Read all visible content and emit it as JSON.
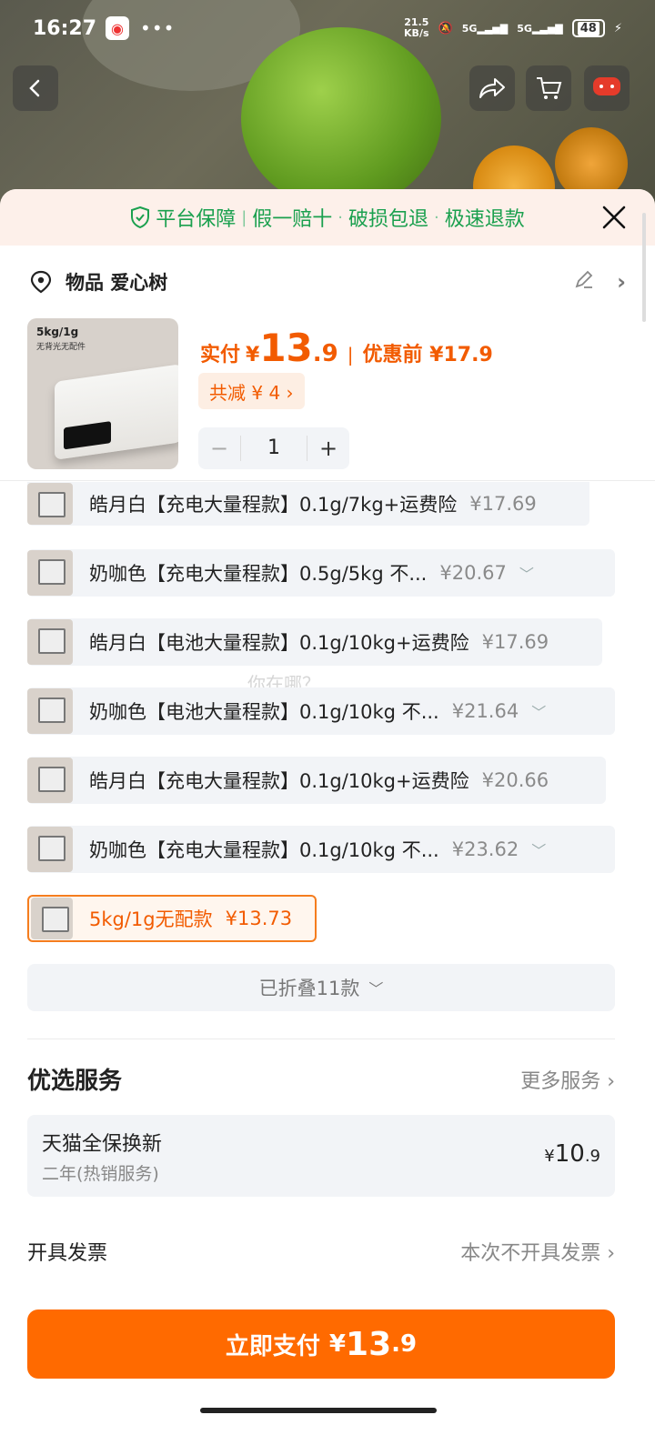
{
  "status": {
    "time": "16:27",
    "dots": "•••",
    "net_speed": "21.5",
    "net_unit": "KB/s",
    "sig1": "5G",
    "sig2": "5G",
    "battery": "48"
  },
  "banner": {
    "shield_label": "平台保障",
    "items": [
      "假一赔十",
      "破损包退",
      "极速退款"
    ],
    "separators": [
      "|",
      "·",
      "·"
    ]
  },
  "address": {
    "text": "物品 爱心树"
  },
  "product": {
    "thumb_title": "5kg/1g",
    "thumb_sub": "无背光无配件",
    "pay_label": "实付",
    "currency": "¥",
    "pay_int": "13",
    "pay_dec": ".9",
    "orig_label": "优惠前 ¥17.9",
    "reduce_label": "共减 ¥ 4 ›",
    "qty": "1",
    "minus": "−",
    "plus": "+"
  },
  "options": [
    {
      "name": "皓月白【充电大量程款】0.1g/7kg+运费险",
      "price": "¥17.69",
      "chev": ""
    },
    {
      "name": "奶咖色【充电大量程款】0.5g/5kg 不...",
      "price": "¥20.67",
      "chev": "﹀"
    },
    {
      "name": "皓月白【电池大量程款】0.1g/10kg+运费险",
      "price": "¥17.69",
      "chev": ""
    },
    {
      "name": "奶咖色【电池大量程款】0.1g/10kg 不...",
      "price": "¥21.64",
      "chev": "﹀"
    },
    {
      "name": "皓月白【充电大量程款】0.1g/10kg+运费险",
      "price": "¥20.66",
      "chev": ""
    },
    {
      "name": "奶咖色【充电大量程款】0.1g/10kg 不...",
      "price": "¥23.62",
      "chev": "﹀"
    },
    {
      "name": "5kg/1g无配款",
      "price": "¥13.73",
      "chev": ""
    }
  ],
  "ghost_text": "你在哪？",
  "folded": {
    "label": "已折叠11款",
    "chev": "﹀"
  },
  "service": {
    "title": "优选服务",
    "more": "更多服务 ›",
    "card_name": "天猫全保换新",
    "card_sub": "二年(热销服务)",
    "card_sym": "¥",
    "card_int": "10",
    "card_dec": ".9"
  },
  "invoice": {
    "label": "开具发票",
    "value": "本次不开具发票 ›"
  },
  "pay_button": {
    "label": "立即支付",
    "sym": "¥",
    "int": "13",
    "dec": ".9"
  },
  "colors": {
    "accent": "#ff6a00",
    "green": "#1aa04e",
    "price": "#f25b00"
  }
}
